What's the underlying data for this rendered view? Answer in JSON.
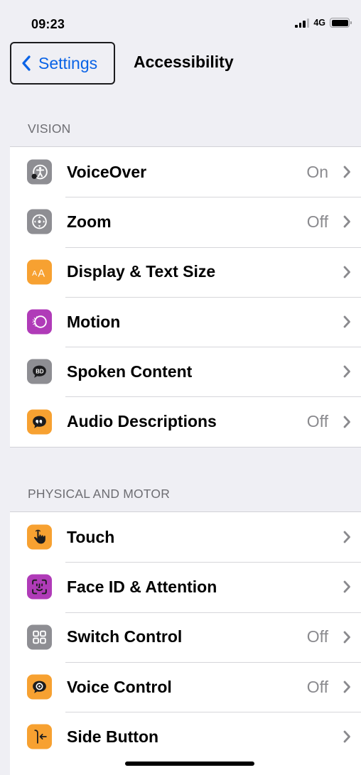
{
  "status_bar": {
    "time": "09:23",
    "network": "4G"
  },
  "nav": {
    "back_label": "Settings",
    "title": "Accessibility"
  },
  "sections": [
    {
      "header": "VISION",
      "rows": [
        {
          "label": "VoiceOver",
          "value": "On",
          "icon": "voiceover-icon",
          "icon_color": "#8e8e93"
        },
        {
          "label": "Zoom",
          "value": "Off",
          "icon": "zoom-icon",
          "icon_color": "#8e8e93"
        },
        {
          "label": "Display & Text Size",
          "value": "",
          "icon": "text-size-icon",
          "icon_color": "#f7a131"
        },
        {
          "label": "Motion",
          "value": "",
          "icon": "motion-icon",
          "icon_color": "#b03bb8"
        },
        {
          "label": "Spoken Content",
          "value": "",
          "icon": "spoken-content-icon",
          "icon_color": "#8e8e93"
        },
        {
          "label": "Audio Descriptions",
          "value": "Off",
          "icon": "audio-descriptions-icon",
          "icon_color": "#f7a131"
        }
      ]
    },
    {
      "header": "PHYSICAL AND MOTOR",
      "rows": [
        {
          "label": "Touch",
          "value": "",
          "icon": "touch-icon",
          "icon_color": "#f7a131"
        },
        {
          "label": "Face ID & Attention",
          "value": "",
          "icon": "face-id-icon",
          "icon_color": "#b03bb8"
        },
        {
          "label": "Switch Control",
          "value": "Off",
          "icon": "switch-control-icon",
          "icon_color": "#8e8e93"
        },
        {
          "label": "Voice Control",
          "value": "Off",
          "icon": "voice-control-icon",
          "icon_color": "#f7a131"
        },
        {
          "label": "Side Button",
          "value": "",
          "icon": "side-button-icon",
          "icon_color": "#f7a131"
        }
      ]
    }
  ]
}
